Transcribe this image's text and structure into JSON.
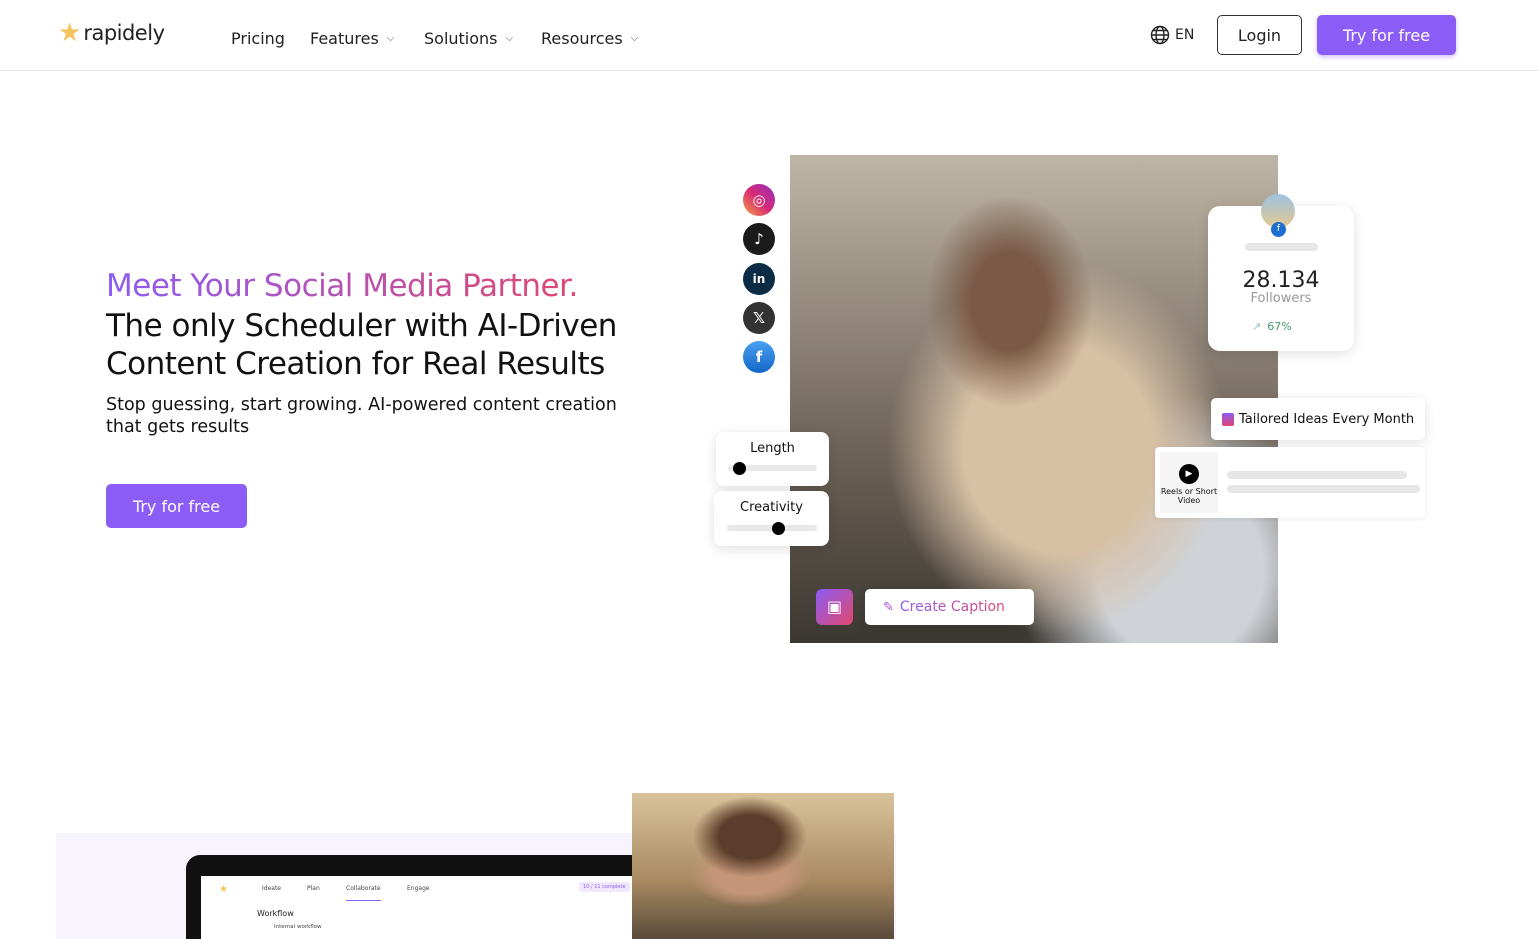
{
  "nav": {
    "logo_text": "rapidely",
    "items": [
      {
        "label": "Pricing"
      },
      {
        "label": "Features",
        "dropdown": true
      },
      {
        "label": "Solutions",
        "dropdown": true
      },
      {
        "label": "Resources",
        "dropdown": true
      }
    ],
    "language": "EN",
    "login_label": "Login",
    "try_label": "Try for free"
  },
  "hero": {
    "headline_accent": "Meet Your Social Media Partner.",
    "headline": "The only Scheduler with AI-Driven Content Creation for Real Results",
    "subtitle": "Stop guessing, start growing. AI-powered content creation that gets results",
    "cta_label": "Try for free"
  },
  "visual": {
    "social_icons": [
      "instagram-icon",
      "tiktok-icon",
      "linkedin-icon",
      "x-icon",
      "facebook-icon"
    ],
    "stats": {
      "value": "28.134",
      "label": "Followers",
      "growth": "67%"
    },
    "tailored_label": "Tailored Ideas Every Month",
    "reels_label": "Reels or Short Video",
    "sliders": [
      {
        "label": "Length",
        "value": 0.12
      },
      {
        "label": "Creativity",
        "value": 0.57
      }
    ],
    "create_caption_label": "Create Caption"
  },
  "preview": {
    "tabs": [
      "Ideate",
      "Plan",
      "Collaborate",
      "Engage"
    ],
    "active_tab": "Collaborate",
    "workflow_title": "Workflow",
    "internal_workflow": "Internal workflow",
    "progress": "10 / 11 complete"
  },
  "colors": {
    "accent": "#8b5cf6",
    "accent_end": "#e0486e",
    "growth": "#4a9a6a"
  }
}
